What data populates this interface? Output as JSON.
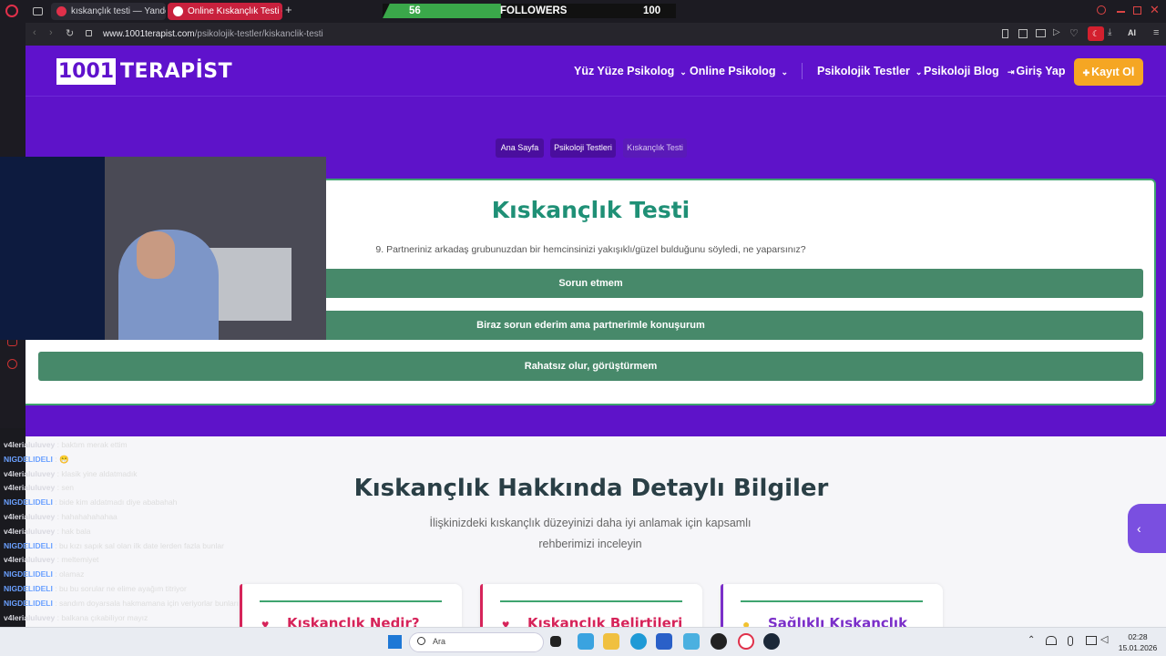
{
  "browser": {
    "tabs": [
      {
        "title": "kıskançlık testi — Yandex"
      },
      {
        "title": "Online Kıskançlık Testi - N"
      }
    ],
    "url_host": "www.1001terapist.com",
    "url_path": "/psikolojik-testler/kiskanclik-testi",
    "zoom_icons": [
      "bookmark-icon",
      "screenshot-icon",
      "download-icon",
      "heart-icon",
      "ai-icon"
    ],
    "ai_label": "AI"
  },
  "overlay": {
    "followers_current": "56",
    "followers_label": "FOLLOWERS",
    "followers_goal": "100",
    "followers_progress": 0.56
  },
  "site": {
    "logo_number": "1001",
    "logo_text": "TERAPİST",
    "nav": {
      "item1": "Yüz Yüze Psikolog",
      "item2": "Online Psikolog",
      "item3": "Psikolojik Testler",
      "item4": "Psikoloji Blog",
      "login": "Giriş Yap",
      "signup": "Kayıt Ol"
    },
    "breadcrumb": [
      "Ana Sayfa",
      "Psikoloji Testleri",
      "Kıskançlık Testi"
    ],
    "test": {
      "title": "Kıskançlık Testi",
      "question": "9. Partneriniz arkadaş grubunuzdan bir hemcinsinizi yakışıklı/güzel bulduğunu söyledi, ne yaparsınız?",
      "answers": [
        "Sorun etmem",
        "Biraz sorun ederim ama partnerimle konuşurum",
        "Rahatsız olur, görüştürmem"
      ]
    },
    "info": {
      "title": "Kıskançlık Hakkında Detaylı Bilgiler",
      "subtitle_line1": "İlişkinizdeki kıskançlık düzeyinizi daha iyi anlamak için kapsamlı",
      "subtitle_line2": "rehberimizi inceleyin",
      "cards": [
        {
          "title": "Kıskançlık Nedir?",
          "color": "#d6245a"
        },
        {
          "title": "Kıskançlık Belirtileri",
          "color": "#d6245a"
        },
        {
          "title": "Sağlıklı Kıskançlık",
          "color": "#7b2fc9"
        }
      ]
    }
  },
  "chat": [
    {
      "user": "v4lerialuluvey",
      "msg": "baktım merak ettim",
      "color": "#d9d9e0"
    },
    {
      "user": "NIGDELIDELI",
      "msg": "😁",
      "color": "#6aa0ff"
    },
    {
      "user": "v4lerialuluvey",
      "msg": "klasik yine aldatmadık",
      "color": "#d9d9e0"
    },
    {
      "user": "v4lerialuluvey",
      "msg": "sen",
      "color": "#d9d9e0"
    },
    {
      "user": "NIGDELIDELI",
      "msg": "bide kim aldatmadı diye ababahah",
      "color": "#6aa0ff"
    },
    {
      "user": "v4lerialuluvey",
      "msg": "hahahahahahaa",
      "color": "#d9d9e0"
    },
    {
      "user": "v4lerialuluvey",
      "msg": "hak bala",
      "color": "#d9d9e0"
    },
    {
      "user": "NIGDELIDELI",
      "msg": "bu kızı sapık sal olan ilk date lerden fazla bunlar",
      "color": "#6aa0ff"
    },
    {
      "user": "v4lerialuluvey",
      "msg": "meltemiyet",
      "color": "#d9d9e0"
    },
    {
      "user": "NIGDELIDELI",
      "msg": "olamaz",
      "color": "#6aa0ff"
    },
    {
      "user": "NIGDELIDELI",
      "msg": "bu bu sorular ne elime ayağım titriyor",
      "color": "#6aa0ff"
    },
    {
      "user": "NIGDELIDELI",
      "msg": "sandım doyarsala hakmamana için veriyorlar bunları",
      "color": "#6aa0ff"
    },
    {
      "user": "v4lerialuluvey",
      "msg": "balkana çıkabiliyor mayız",
      "color": "#d9d9e0"
    },
    {
      "user": "NIGDELIDELI",
      "msg": "imkansız",
      "color": "#6aa0ff"
    },
    {
      "user": "v4lerialuluvey",
      "msg": "bu pipe ne sevim",
      "color": "#d9d9e0"
    }
  ],
  "taskbar": {
    "search_placeholder": "Ara",
    "time": "02:28",
    "date": "15.01.2026"
  }
}
